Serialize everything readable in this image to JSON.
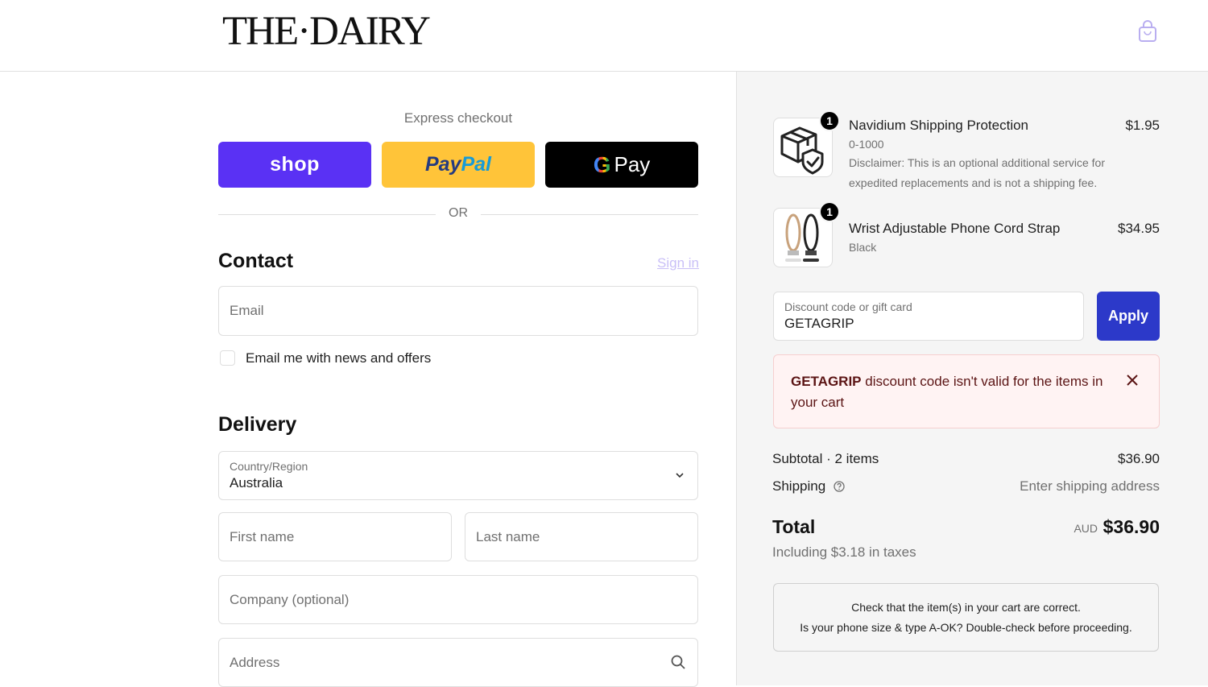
{
  "header": {
    "logo": "THE·DAIRY",
    "cart_icon": "shopping-bag-icon"
  },
  "express": {
    "label": "Express checkout",
    "shop_label": "shop",
    "paypal_part1": "Pay",
    "paypal_part2": "Pal",
    "gpay_g": "G",
    "gpay_label": "Pay",
    "or_label": "OR"
  },
  "contact": {
    "title": "Contact",
    "signin_label": "Sign in",
    "email_placeholder": "Email",
    "newsletter_label": "Email me with news and offers"
  },
  "delivery": {
    "title": "Delivery",
    "country_label": "Country/Region",
    "country_value": "Australia",
    "first_name_placeholder": "First name",
    "last_name_placeholder": "Last name",
    "company_placeholder": "Company (optional)",
    "address_placeholder": "Address"
  },
  "cart": {
    "items": [
      {
        "title": "Navidium Shipping Protection",
        "variant": "0-1000",
        "description": "Disclaimer: This is an optional additional service for expedited replacements and is not a shipping fee.",
        "price": "$1.95",
        "quantity": "1",
        "icon": "shipping-protection-box-icon"
      },
      {
        "title": "Wrist Adjustable Phone Cord Strap",
        "variant": "Black",
        "price": "$34.95",
        "quantity": "1",
        "icon": "phone-strap-image"
      }
    ]
  },
  "discount": {
    "label": "Discount code or gift card",
    "value": "GETAGRIP",
    "apply_label": "Apply",
    "error_code": "GETAGRIP",
    "error_message": " discount code isn't valid for the items in your cart"
  },
  "summary": {
    "subtotal_label": "Subtotal · 2 items",
    "subtotal_value": "$36.90",
    "shipping_label": "Shipping",
    "shipping_value": "Enter shipping address",
    "total_label": "Total",
    "currency": "AUD",
    "total_value": "$36.90",
    "taxes_label": "Including $3.18 in taxes"
  },
  "note": {
    "line1": "Check that the item(s) in your cart are correct.",
    "line2": "Is your phone size & type A-OK? Double-check before proceeding."
  },
  "colors": {
    "shop_purple": "#5a31f4",
    "paypal_yellow": "#ffc439",
    "apply_blue": "#2c39c9",
    "error_bg": "#fff3f3"
  }
}
